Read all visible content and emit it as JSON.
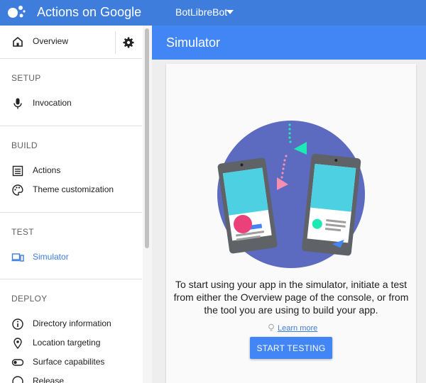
{
  "topbar": {
    "app_title": "Actions on Google",
    "project_name": "BotLibreBot",
    "logo_icon": "google-assistant-dots-icon",
    "caret_icon": "caret-down-icon"
  },
  "sidebar": {
    "overview": {
      "label": "Overview",
      "icon": "home-icon"
    },
    "settings_icon": "gear-icon",
    "sections": [
      {
        "title": "SETUP",
        "items": [
          {
            "label": "Invocation",
            "icon": "microphone-icon"
          }
        ]
      },
      {
        "title": "BUILD",
        "items": [
          {
            "label": "Actions",
            "icon": "list-icon"
          },
          {
            "label": "Theme customization",
            "icon": "palette-icon"
          }
        ]
      },
      {
        "title": "TEST",
        "items": [
          {
            "label": "Simulator",
            "icon": "devices-icon",
            "active": true
          }
        ]
      },
      {
        "title": "DEPLOY",
        "items": [
          {
            "label": "Directory information",
            "icon": "info-icon"
          },
          {
            "label": "Location targeting",
            "icon": "location-pin-icon"
          },
          {
            "label": "Surface capabilites",
            "icon": "toggle-icon"
          },
          {
            "label": "Release",
            "icon": "release-icon"
          }
        ]
      }
    ]
  },
  "main": {
    "title": "Simulator",
    "description": "To start using your app in the simulator, initiate a test from either the Overview page of the console, or from the tool you are using to build your app.",
    "learn_more": "Learn more",
    "learn_more_icon": "lightbulb-icon",
    "start_button": "START TESTING"
  },
  "colors": {
    "topbar": "#3f7ddc",
    "header": "#4285f4",
    "accent": "#4285f4",
    "illustration_circle": "#5c6bc0"
  }
}
